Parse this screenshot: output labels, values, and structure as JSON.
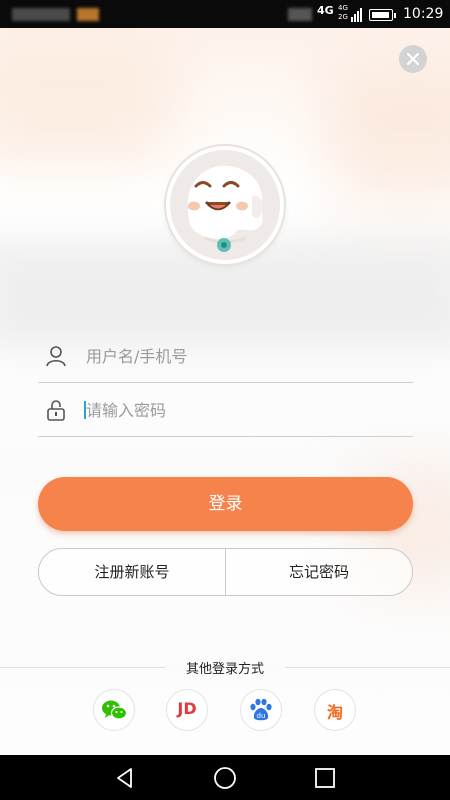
{
  "status_bar": {
    "network_primary": "4G",
    "network_secondary_top": "4G",
    "network_secondary_bottom": "2G",
    "battery_level": 0.85,
    "time": "10:29"
  },
  "login": {
    "username_placeholder": "用户名/手机号",
    "password_placeholder": "请输入密码",
    "login_button": "登录",
    "register_button": "注册新账号",
    "forgot_button": "忘记密码",
    "other_methods_label": "其他登录方式",
    "social_logins": [
      {
        "name": "wechat",
        "label": ""
      },
      {
        "name": "jd",
        "label": "JD"
      },
      {
        "name": "baidu",
        "label": "du"
      },
      {
        "name": "taobao",
        "label": "淘"
      }
    ]
  },
  "colors": {
    "accent": "#f5834b",
    "wechat": "#2dc100",
    "jd": "#e03a3a",
    "baidu": "#2e76e6",
    "taobao": "#f26b1d"
  },
  "icons": {
    "close": "close-icon",
    "user": "user-icon",
    "lock": "lock-icon",
    "back": "back-icon",
    "home": "home-icon",
    "recents": "recents-icon"
  }
}
